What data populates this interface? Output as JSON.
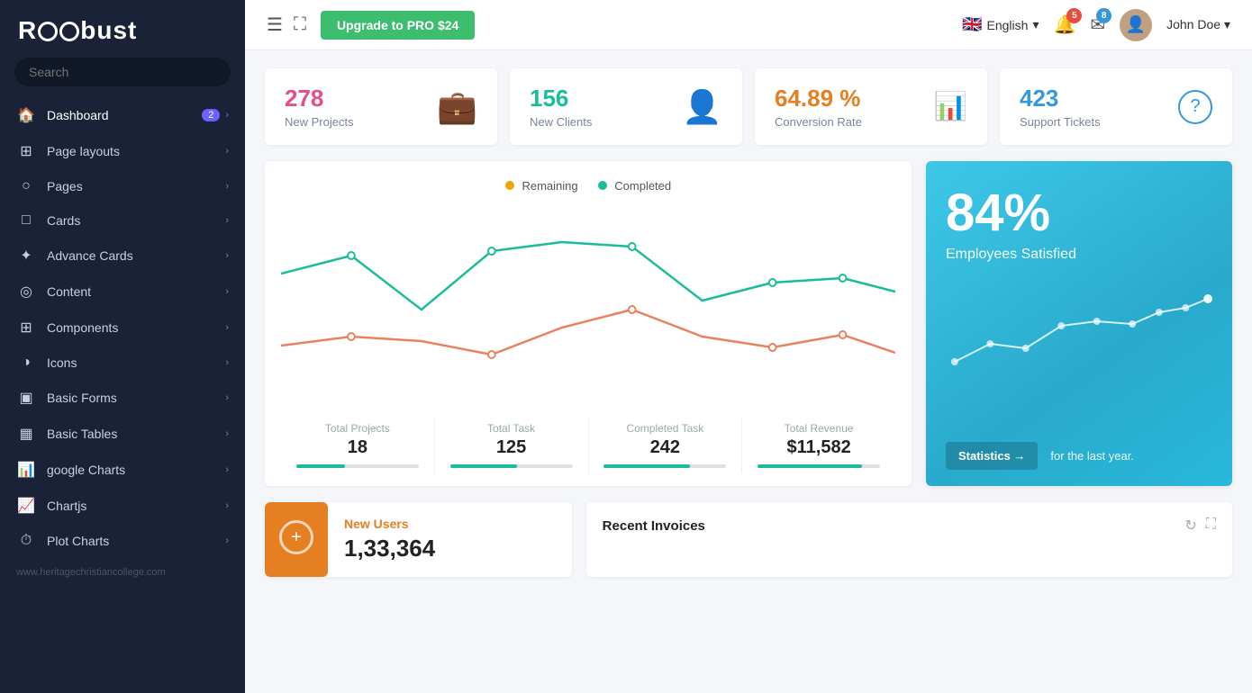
{
  "sidebar": {
    "logo": "Robust",
    "search_placeholder": "Search",
    "items": [
      {
        "id": "dashboard",
        "label": "Dashboard",
        "icon": "🏠",
        "badge": "2",
        "arrow": true
      },
      {
        "id": "page-layouts",
        "label": "Page layouts",
        "icon": "⊞",
        "badge": "",
        "arrow": true
      },
      {
        "id": "pages",
        "label": "Pages",
        "icon": "○",
        "badge": "",
        "arrow": true
      },
      {
        "id": "cards",
        "label": "Cards",
        "icon": "□",
        "badge": "",
        "arrow": true
      },
      {
        "id": "advance-cards",
        "label": "Advance Cards",
        "icon": "✦",
        "badge": "",
        "arrow": true
      },
      {
        "id": "content",
        "label": "Content",
        "icon": "◎",
        "badge": "",
        "arrow": true
      },
      {
        "id": "components",
        "label": "Components",
        "icon": "⊞",
        "badge": "",
        "arrow": true
      },
      {
        "id": "icons",
        "label": "Icons",
        "icon": "◑",
        "badge": "",
        "arrow": true
      },
      {
        "id": "basic-forms",
        "label": "Basic Forms",
        "icon": "▣",
        "badge": "",
        "arrow": true
      },
      {
        "id": "basic-tables",
        "label": "Basic Tables",
        "icon": "▦",
        "badge": "",
        "arrow": true
      },
      {
        "id": "google-charts",
        "label": "google Charts",
        "icon": "📊",
        "badge": "",
        "arrow": true
      },
      {
        "id": "chartjs",
        "label": "Chartjs",
        "icon": "📈",
        "badge": "",
        "arrow": true
      },
      {
        "id": "plot-charts",
        "label": "Plot Charts",
        "icon": "⏱",
        "badge": "",
        "arrow": true
      }
    ],
    "footer_text": "www.heritagechristiancollege.com"
  },
  "topbar": {
    "menu_icon": "☰",
    "expand_icon": "⛶",
    "upgrade_label": "Upgrade to PRO $24",
    "language": "English",
    "notifications_count": "5",
    "messages_count": "8",
    "user_name": "John Doe"
  },
  "stats": [
    {
      "value": "278",
      "label": "New Projects",
      "icon": "💼",
      "color": "color-pink"
    },
    {
      "value": "156",
      "label": "New Clients",
      "icon": "👤",
      "color": "color-teal"
    },
    {
      "value": "64.89 %",
      "label": "Conversion Rate",
      "icon": "📊",
      "color": "color-orange"
    },
    {
      "value": "423",
      "label": "Support Tickets",
      "icon": "❓",
      "color": "color-blue"
    }
  ],
  "chart": {
    "legend": [
      {
        "label": "Remaining",
        "color": "#f0a500"
      },
      {
        "label": "Completed",
        "color": "#1abc9c"
      }
    ],
    "stats": [
      {
        "label": "Total Projects",
        "value": "18",
        "bar_pct": 40
      },
      {
        "label": "Total Task",
        "value": "125",
        "bar_pct": 55
      },
      {
        "label": "Completed Task",
        "value": "242",
        "bar_pct": 70
      },
      {
        "label": "Total Revenue",
        "value": "$11,582",
        "bar_pct": 85
      }
    ]
  },
  "blue_card": {
    "percentage": "84%",
    "label": "Employees Satisfied",
    "stats_btn": "Statistics →",
    "sub_label": "for the last year."
  },
  "bottom": {
    "new_users_label": "New Users",
    "new_users_value": "1,33,364",
    "recent_invoices_title": "Recent Invoices"
  }
}
